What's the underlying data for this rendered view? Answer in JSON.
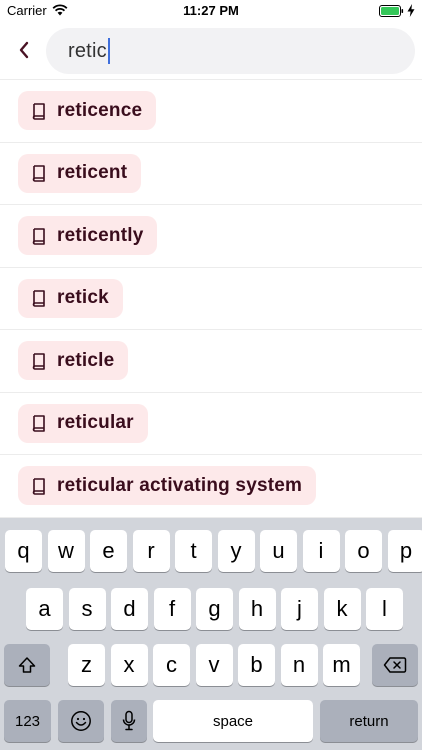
{
  "status_bar": {
    "carrier": "Carrier",
    "time": "11:27 PM"
  },
  "search": {
    "query": "retic"
  },
  "results": [
    "reticence",
    "reticent",
    "reticently",
    "retick",
    "reticle",
    "reticular",
    "reticular activating system"
  ],
  "keyboard": {
    "row1": [
      "q",
      "w",
      "e",
      "r",
      "t",
      "y",
      "u",
      "i",
      "o",
      "p"
    ],
    "row2": [
      "a",
      "s",
      "d",
      "f",
      "g",
      "h",
      "j",
      "k",
      "l"
    ],
    "row3": [
      "z",
      "x",
      "c",
      "v",
      "b",
      "n",
      "m"
    ],
    "numbers_label": "123",
    "space_label": "space",
    "return_label": "return"
  },
  "colors": {
    "chip_bg": "#fde9ea",
    "chip_text": "#3a0d1d",
    "caret": "#3f6fdc",
    "keyboard_bg": "#d2d5db"
  }
}
